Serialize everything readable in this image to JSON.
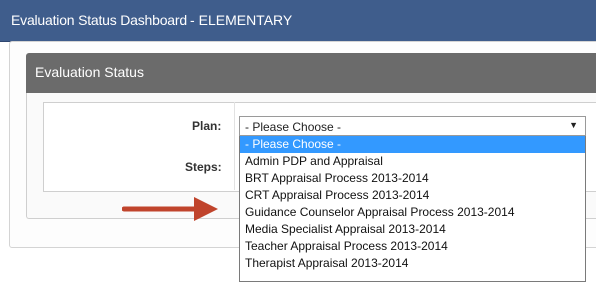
{
  "header": {
    "title": "Evaluation Status Dashboard",
    "separator": "-",
    "school": "ELEMENTARY"
  },
  "panel": {
    "title": "Evaluation Status"
  },
  "form": {
    "plan_label": "Plan:",
    "steps_label": "Steps:",
    "plan_selected": "- Please Choose -",
    "plan_options": [
      "- Please Choose -",
      "Admin PDP and Appraisal",
      "BRT Appraisal Process 2013-2014",
      "CRT Appraisal Process 2013-2014",
      "Guidance Counselor Appraisal Process 2013-2014",
      "Media Specialist Appraisal 2013-2014",
      "Teacher Appraisal Process 2013-2014",
      "Therapist Appraisal 2013-2014"
    ]
  },
  "colors": {
    "header_bg": "#3f5d8c",
    "panel_head_bg": "#6b6b6b",
    "highlight": "#3399ff",
    "annotation_arrow": "#c0442c"
  },
  "icons": {
    "select_arrow": "▼"
  }
}
